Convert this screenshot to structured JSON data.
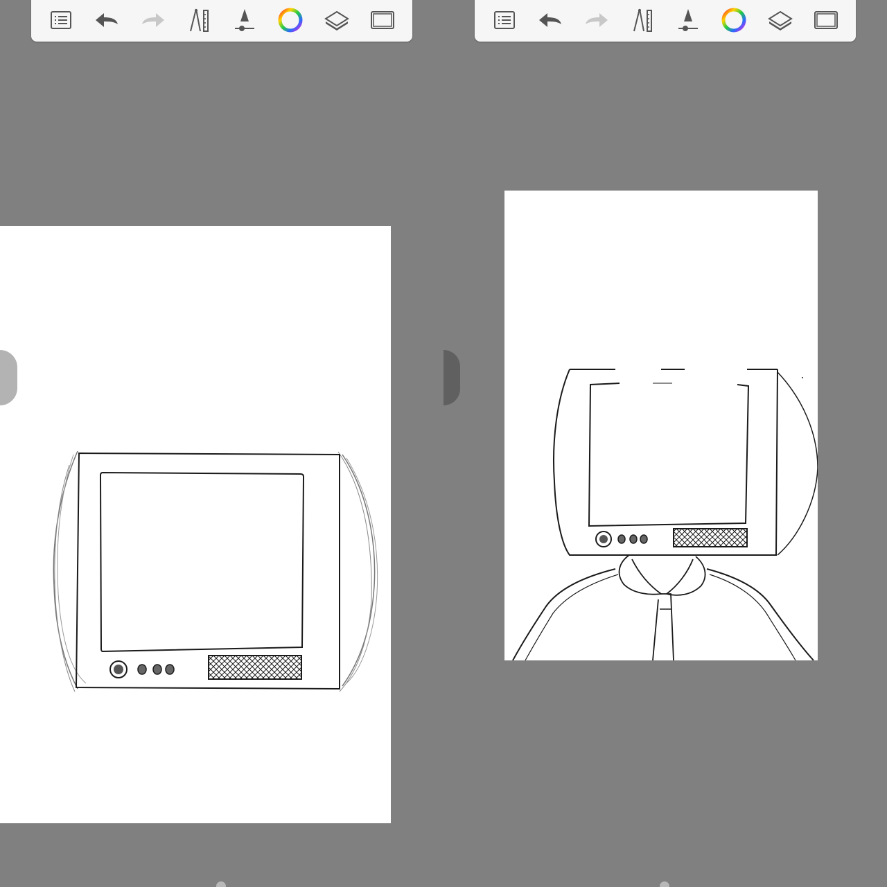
{
  "panes": [
    {
      "toolbar": {
        "tools": [
          {
            "name": "menu",
            "icon": "list-icon"
          },
          {
            "name": "undo",
            "icon": "undo-arrow-icon",
            "enabled": true
          },
          {
            "name": "redo",
            "icon": "redo-arrow-icon",
            "enabled": false
          },
          {
            "name": "ruler",
            "icon": "compass-ruler-icon"
          },
          {
            "name": "brush",
            "icon": "brush-cone-icon"
          },
          {
            "name": "color",
            "icon": "color-wheel-icon"
          },
          {
            "name": "layers",
            "icon": "layers-icon"
          },
          {
            "name": "fullscreen",
            "icon": "frame-icon"
          }
        ]
      },
      "canvas": {
        "drawing": "tv-sketch-with-guide-strokes"
      }
    },
    {
      "toolbar": {
        "tools": [
          {
            "name": "menu",
            "icon": "list-icon"
          },
          {
            "name": "undo",
            "icon": "undo-arrow-icon",
            "enabled": true
          },
          {
            "name": "redo",
            "icon": "redo-arrow-icon",
            "enabled": false
          },
          {
            "name": "ruler",
            "icon": "compass-ruler-icon"
          },
          {
            "name": "brush",
            "icon": "brush-cone-icon"
          },
          {
            "name": "color",
            "icon": "color-wheel-icon"
          },
          {
            "name": "layers",
            "icon": "layers-icon"
          },
          {
            "name": "fullscreen",
            "icon": "frame-icon"
          }
        ]
      },
      "canvas": {
        "drawing": "tv-head-figure-with-collar-and-tie"
      }
    }
  ],
  "colors": {
    "workspace": "#808080",
    "toolbar": "#f6f6f6",
    "paper": "#ffffff",
    "ink": "#1a1a1a",
    "icon": "#555555",
    "icon_disabled": "#c8c8c8"
  }
}
